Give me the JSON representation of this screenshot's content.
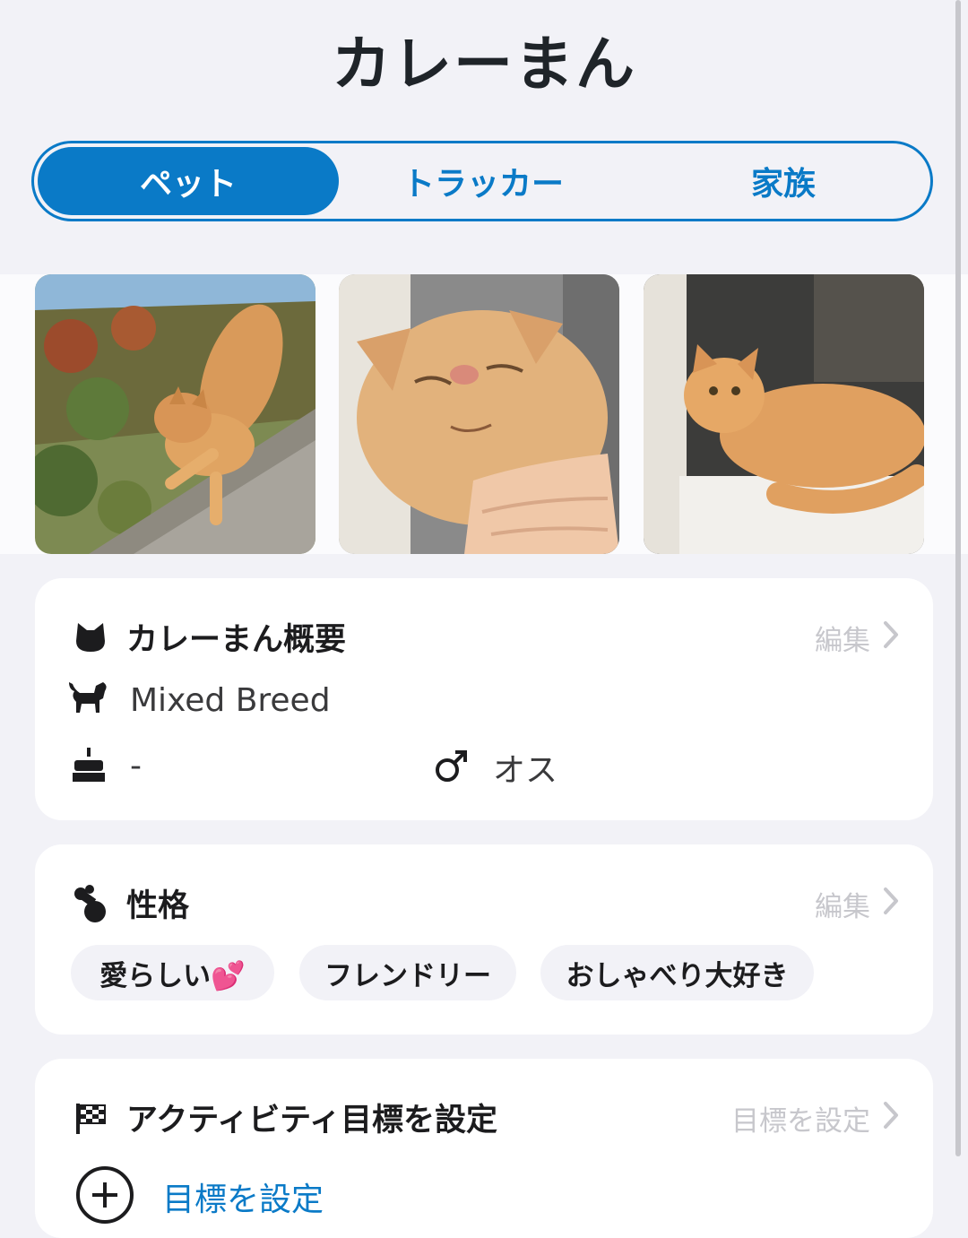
{
  "header": {
    "title": "カレーまん"
  },
  "tabs": [
    {
      "label": "ペット",
      "active": true
    },
    {
      "label": "トラッカー",
      "active": false
    },
    {
      "label": "家族",
      "active": false
    }
  ],
  "photos": [
    "cat-stretching-photo",
    "cat-chin-scratch-photo",
    "cat-lying-photo"
  ],
  "overview": {
    "title": "カレーまん概要",
    "edit_label": "編集",
    "breed": "Mixed Breed",
    "birthday": "-",
    "sex": "オス",
    "icons": {
      "header": "cat-head-icon",
      "breed": "cat-icon",
      "birthday": "cake-icon",
      "sex": "male-symbol-icon"
    }
  },
  "personality": {
    "title": "性格",
    "edit_label": "編集",
    "tags": [
      "愛らしい💕",
      "フレンドリー",
      "おしゃべり大好き"
    ]
  },
  "activity": {
    "title": "アクティビティ目標を設定",
    "action_label": "目標を設定",
    "add_label": "目標を設定"
  },
  "colors": {
    "accent": "#0a7ac7",
    "background": "#f2f2f7",
    "card": "#ffffff",
    "muted": "#c7c7cc"
  }
}
